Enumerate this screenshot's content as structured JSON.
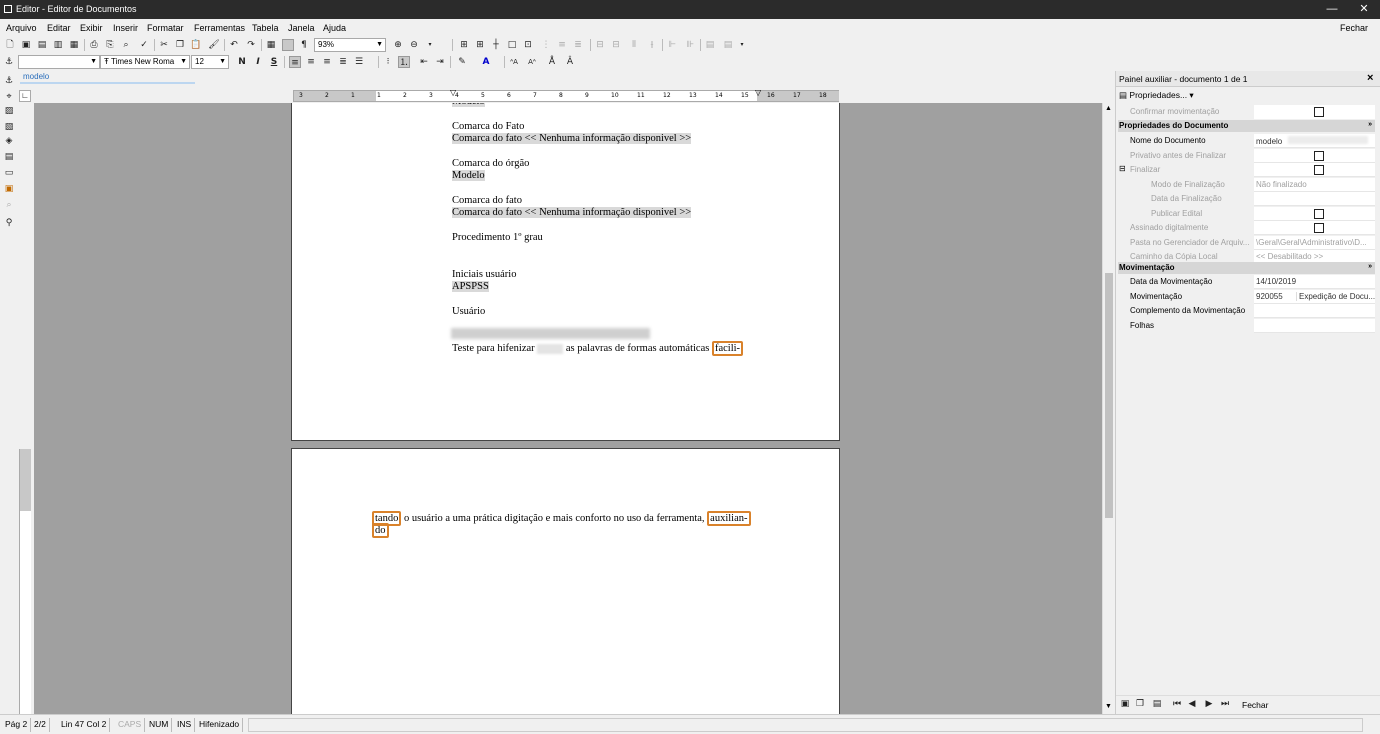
{
  "window": {
    "title": "Editor - Editor de Documentos",
    "close_label": "Fechar"
  },
  "menu": [
    "Arquivo",
    "Editar",
    "Exibir",
    "Inserir",
    "Formatar",
    "Ferramentas",
    "Tabela",
    "Janela",
    "Ajuda"
  ],
  "toolbar": {
    "zoom": "93%",
    "font": "Times New Roma",
    "font_size": "12",
    "bold": "N",
    "italic": "I",
    "underline": "S"
  },
  "style_tab": "modelo",
  "ruler_labels": [
    "3",
    "2",
    "1",
    "1",
    "2",
    "3",
    "4",
    "5",
    "6",
    "7",
    "8",
    "9",
    "10",
    "11",
    "12",
    "13",
    "14",
    "15",
    "16",
    "17",
    "18"
  ],
  "document": {
    "page1": {
      "lines": [
        {
          "text": "Modelo",
          "shaded": true
        },
        {
          "text": "Comarca do Fato",
          "shaded": false
        },
        {
          "text": "Comarca do fato << Nenhuma informação disponivel >>",
          "shaded": true
        },
        {
          "text": "Comarca do órgão",
          "shaded": false
        },
        {
          "text": "Modelo",
          "shaded": true
        },
        {
          "text": "Comarca do fato",
          "shaded": false
        },
        {
          "text": "Comarca do fato << Nenhuma informação disponivel >>",
          "shaded": true
        },
        {
          "text": "Procedimento 1º grau",
          "shaded": false
        },
        {
          "text": "Iniciais usuário",
          "shaded": false
        },
        {
          "text": "APSPSS",
          "shaded": true
        },
        {
          "text": "Usuário",
          "shaded": false
        }
      ],
      "hyph_prefix": "Teste para hifenizar",
      "hyph_middle": "as palavras de formas automáticas",
      "hyph_end": "facili-"
    },
    "page2": {
      "start": "tando",
      "middle": "o usuário a uma prática digitação e mais conforto no uso da ferramenta,",
      "end": "auxilian-",
      "next": "do"
    }
  },
  "panel": {
    "title": "Painel auxiliar - documento 1 de 1",
    "close": "×",
    "props_button": "Propriedades...",
    "confirm_label": "Confirmar movimentação",
    "section_doc": "Propriedades do Documento",
    "doc_rows": [
      {
        "label": "Nome do Documento",
        "value": "modelo",
        "disabled": false,
        "check": false
      },
      {
        "label": "Privativo antes de Finalizar",
        "value": "",
        "disabled": true,
        "check": true
      },
      {
        "label": "Finalizar",
        "value": "",
        "disabled": true,
        "check": true
      },
      {
        "label": "Modo de Finalização",
        "value": "Não finalizado",
        "disabled": true,
        "check": false
      },
      {
        "label": "Data da Finalização",
        "value": "",
        "disabled": true,
        "check": false
      },
      {
        "label": "Publicar Edital",
        "value": "",
        "disabled": true,
        "check": true
      },
      {
        "label": "Assinado digitalmente",
        "value": "",
        "disabled": true,
        "check": true
      },
      {
        "label": "Pasta no Gerenciador de Arquiv...",
        "value": "\\Geral\\Geral\\Administrativo\\D...",
        "disabled": true,
        "check": false
      },
      {
        "label": "Caminho da Cópia Local",
        "value": "<< Desabilitado >>",
        "disabled": true,
        "check": false
      }
    ],
    "section_mov": "Movimentação",
    "mov_rows": [
      {
        "label": "Data da Movimentação",
        "value": "14/10/2019"
      },
      {
        "label": "Movimentação",
        "value": "920055",
        "value2": "Expedição de Docu..."
      },
      {
        "label": "Complemento da Movimentação",
        "value": ""
      },
      {
        "label": "Folhas",
        "value": ""
      }
    ],
    "footer_close": "Fechar"
  },
  "status": {
    "page": "Pág 2",
    "pages": "2/2",
    "pos": "Lin 47  Col 2",
    "caps": "CAPS",
    "num": "NUM",
    "ins": "INS",
    "hyph": "Hifenizado"
  }
}
